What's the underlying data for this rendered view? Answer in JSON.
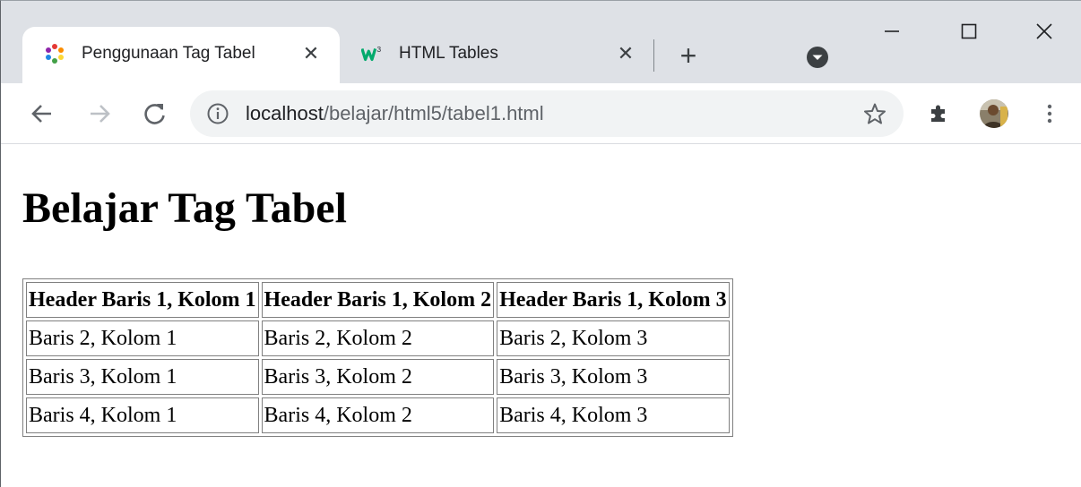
{
  "browser": {
    "tabs": [
      {
        "title": "Penggunaan Tag Tabel",
        "favicon": "colorful-gear-icon",
        "active": true,
        "close_glyph": "✕"
      },
      {
        "title": "HTML Tables",
        "favicon": "w3schools-icon",
        "active": false,
        "close_glyph": "✕"
      }
    ],
    "new_tab_glyph": "+",
    "window_controls": {
      "minimize": "─",
      "maximize": "☐",
      "close": "✕"
    },
    "address": {
      "host": "localhost",
      "path": "/belajar/html5/tabel1.html"
    },
    "colors": {
      "tabstrip": "#dee1e6",
      "omnibox": "#f1f3f4"
    }
  },
  "page": {
    "title": "Belajar Tag Tabel",
    "table": {
      "headers": [
        "Header Baris 1, Kolom 1",
        "Header Baris 1, Kolom 2",
        "Header Baris 1, Kolom 3"
      ],
      "rows": [
        [
          "Baris 2, Kolom 1",
          "Baris 2, Kolom 2",
          "Baris 2, Kolom 3"
        ],
        [
          "Baris 3, Kolom 1",
          "Baris 3, Kolom 2",
          "Baris 3, Kolom 3"
        ],
        [
          "Baris 4, Kolom 1",
          "Baris 4, Kolom 2",
          "Baris 4, Kolom 3"
        ]
      ]
    }
  }
}
